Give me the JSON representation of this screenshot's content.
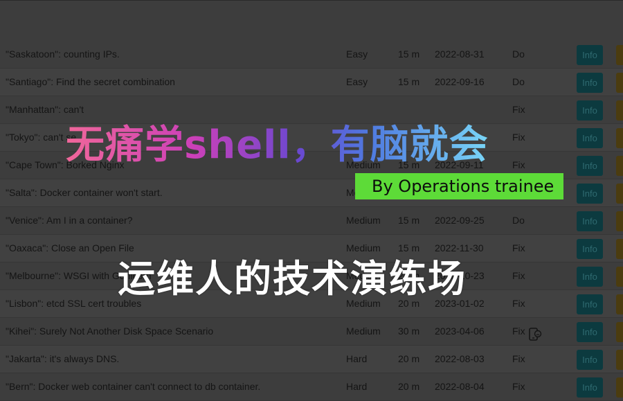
{
  "scenarios": [
    {
      "title": "\"Saskatoon\": counting IPs.",
      "difficulty": "Easy",
      "time": "15 m",
      "date": "2022-08-31",
      "type": "Do",
      "info_label": "Info"
    },
    {
      "title": "\"Santiago\": Find the secret combination",
      "difficulty": "Easy",
      "time": "15 m",
      "date": "2022-09-16",
      "type": "Do",
      "info_label": "Info"
    },
    {
      "title": "\"Manhattan\": can't",
      "difficulty": "",
      "time": "",
      "date": "",
      "type": "Fix",
      "info_label": "Info"
    },
    {
      "title": "\"Tokyo\": can't se",
      "difficulty": "",
      "time": "",
      "date": "",
      "type": "Fix",
      "info_label": "Info"
    },
    {
      "title": "\"Cape Town\": Borked Nginx",
      "difficulty": "Medium",
      "time": "15 m",
      "date": "2022-09-11",
      "type": "Fix",
      "info_label": "Info"
    },
    {
      "title": "\"Salta\": Docker container won't start.",
      "difficulty": "Medium",
      "time": "",
      "date": "",
      "type": "",
      "info_label": "Info"
    },
    {
      "title": "\"Venice\": Am I in a container?",
      "difficulty": "Medium",
      "time": "15 m",
      "date": "2022-09-25",
      "type": "Do",
      "info_label": "Info"
    },
    {
      "title": "\"Oaxaca\": Close an Open File",
      "difficulty": "Medium",
      "time": "15 m",
      "date": "2022-11-30",
      "type": "Fix",
      "info_label": "Info"
    },
    {
      "title": "\"Melbourne\": WSGI with Gunicorn",
      "difficulty": "Medium",
      "time": "20 m",
      "date": "2022-10-23",
      "type": "Fix",
      "info_label": "Info"
    },
    {
      "title": "\"Lisbon\": etcd SSL cert troubles",
      "difficulty": "Medium",
      "time": "20 m",
      "date": "2023-01-02",
      "type": "Fix",
      "info_label": "Info"
    },
    {
      "title": "\"Kihei\": Surely Not Another Disk Space Scenario",
      "difficulty": "Medium",
      "time": "30 m",
      "date": "2023-04-06",
      "type": "Fix",
      "info_label": "Info",
      "icon": "mobile-unsupported-icon"
    },
    {
      "title": "\"Jakarta\": it's always DNS.",
      "difficulty": "Hard",
      "time": "20 m",
      "date": "2022-08-03",
      "type": "Fix",
      "info_label": "Info"
    },
    {
      "title": "\"Bern\": Docker web container can't connect to db container.",
      "difficulty": "Hard",
      "time": "20 m",
      "date": "2022-08-04",
      "type": "Fix",
      "info_label": "Info"
    }
  ],
  "overlay": {
    "title": "无痛学shell，有脑就会",
    "badge": "By Operations trainee",
    "subtitle": "运维人的技术演练场"
  },
  "colors": {
    "info_button": "#0c3a3f",
    "warn_button": "#4b3c10",
    "badge_bg": "#5ddb38",
    "gradient": [
      "#f0679a",
      "#cc40b8",
      "#6a48d0",
      "#4f7ae0",
      "#79d6f7"
    ]
  }
}
